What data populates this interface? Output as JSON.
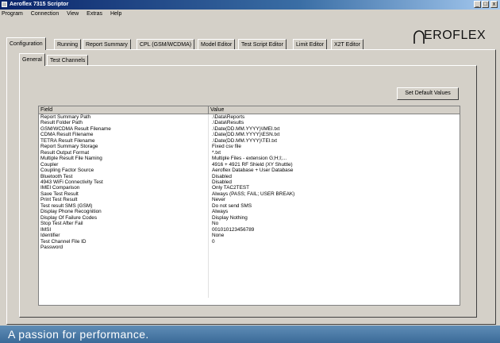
{
  "window": {
    "title": "Aeroflex 7315 Scriptor",
    "minimize": "_",
    "maximize": "□",
    "close": "x"
  },
  "menu": [
    "Program",
    "Connection",
    "View",
    "Extras",
    "Help"
  ],
  "logo": {
    "text": "EROFLEX"
  },
  "main_tabs": [
    "Configuration",
    "Running",
    "Report Summary",
    "CPL (GSM/WCDMA)",
    "Model Editor",
    "Test Script Editor",
    "Limit Editor",
    "X2T Editor"
  ],
  "sub_tabs": [
    "General",
    "Test Channels"
  ],
  "buttons": {
    "set_default": "Set Default Values"
  },
  "grid": {
    "headers": [
      "Field",
      "Value"
    ],
    "rows": [
      [
        "Report Summary Path",
        ".\\Data\\Reports"
      ],
      [
        "Result Folder Path",
        ".\\Data\\Results"
      ],
      [
        "GSM/WCDMA Result Filename",
        ".\\Date(DD.MM.YYYY)\\IMEI.txt"
      ],
      [
        "CDMA Result Filename",
        ".\\Date(DD.MM.YYYY)\\ESN.txt"
      ],
      [
        "TETRA Result Filename",
        ".\\Date(DD.MM.YYYY)\\TEI.txt"
      ],
      [
        "Report Summary Storage",
        "Fixed csv file"
      ],
      [
        "Result Output Format",
        "*.txt"
      ],
      [
        "Multiple Result File Naming",
        "Multiple Files - extension G;H;I;..."
      ],
      [
        "Coupler",
        "4916 + 4921 RF Shield (XY Shuttle)"
      ],
      [
        "Coupling Factor Source",
        "Aeroflex Database + User Database"
      ],
      [
        "Bluetooth Test",
        "Disabled"
      ],
      [
        "4943 WiFi Connectivity Test",
        "Disabled"
      ],
      [
        "IMEI Comparison",
        "Only TAC2TEST"
      ],
      [
        "Save Test Result",
        "Always (PASS; FAIL; USER BREAK)"
      ],
      [
        "Print Test Result",
        "Never"
      ],
      [
        "Test result SMS (GSM)",
        "Do not send SMS"
      ],
      [
        "Display Phone Recognition",
        "Always"
      ],
      [
        "Display Of Failure Codes",
        "Display Nothing"
      ],
      [
        "Stop Test After Fail",
        "No"
      ],
      [
        "IMSI",
        "001010123456789"
      ],
      [
        "Identifier",
        "None"
      ],
      [
        "Test Channel File ID",
        "0"
      ],
      [
        "Password",
        ""
      ],
      [
        "",
        ""
      ],
      [
        "",
        ""
      ],
      [
        "",
        ""
      ],
      [
        "",
        ""
      ],
      [
        "",
        ""
      ],
      [
        "",
        ""
      ],
      [
        "",
        ""
      ],
      [
        "",
        ""
      ]
    ]
  },
  "footer": {
    "slogan": "A passion for performance."
  }
}
